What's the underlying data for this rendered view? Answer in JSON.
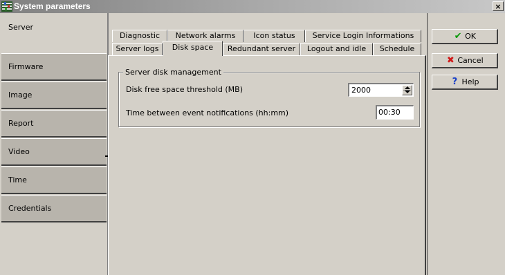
{
  "window": {
    "title": "System parameters",
    "close_label": "×"
  },
  "sidebar": {
    "items": [
      {
        "label": "Server",
        "active": true
      },
      {
        "label": "Firmware"
      },
      {
        "label": "Image"
      },
      {
        "label": "Report"
      },
      {
        "label": "Video"
      },
      {
        "label": "Time"
      },
      {
        "label": "Credentials"
      }
    ]
  },
  "tabs": {
    "row1": [
      "Diagnostic",
      "Network alarms",
      "Icon status",
      "Service Login Informations"
    ],
    "row2": [
      "Server logs",
      "Disk space",
      "Redundant server",
      "Logout and idle",
      "Schedule"
    ],
    "active": "Disk space"
  },
  "disk": {
    "group_title": "Server disk management",
    "threshold_label": "Disk free space threshold (MB)",
    "threshold_value": "2000",
    "interval_label": "Time between event notifications (hh:mm)",
    "interval_value": "00:30"
  },
  "actions": {
    "ok": "OK",
    "cancel": "Cancel",
    "help": "Help"
  }
}
